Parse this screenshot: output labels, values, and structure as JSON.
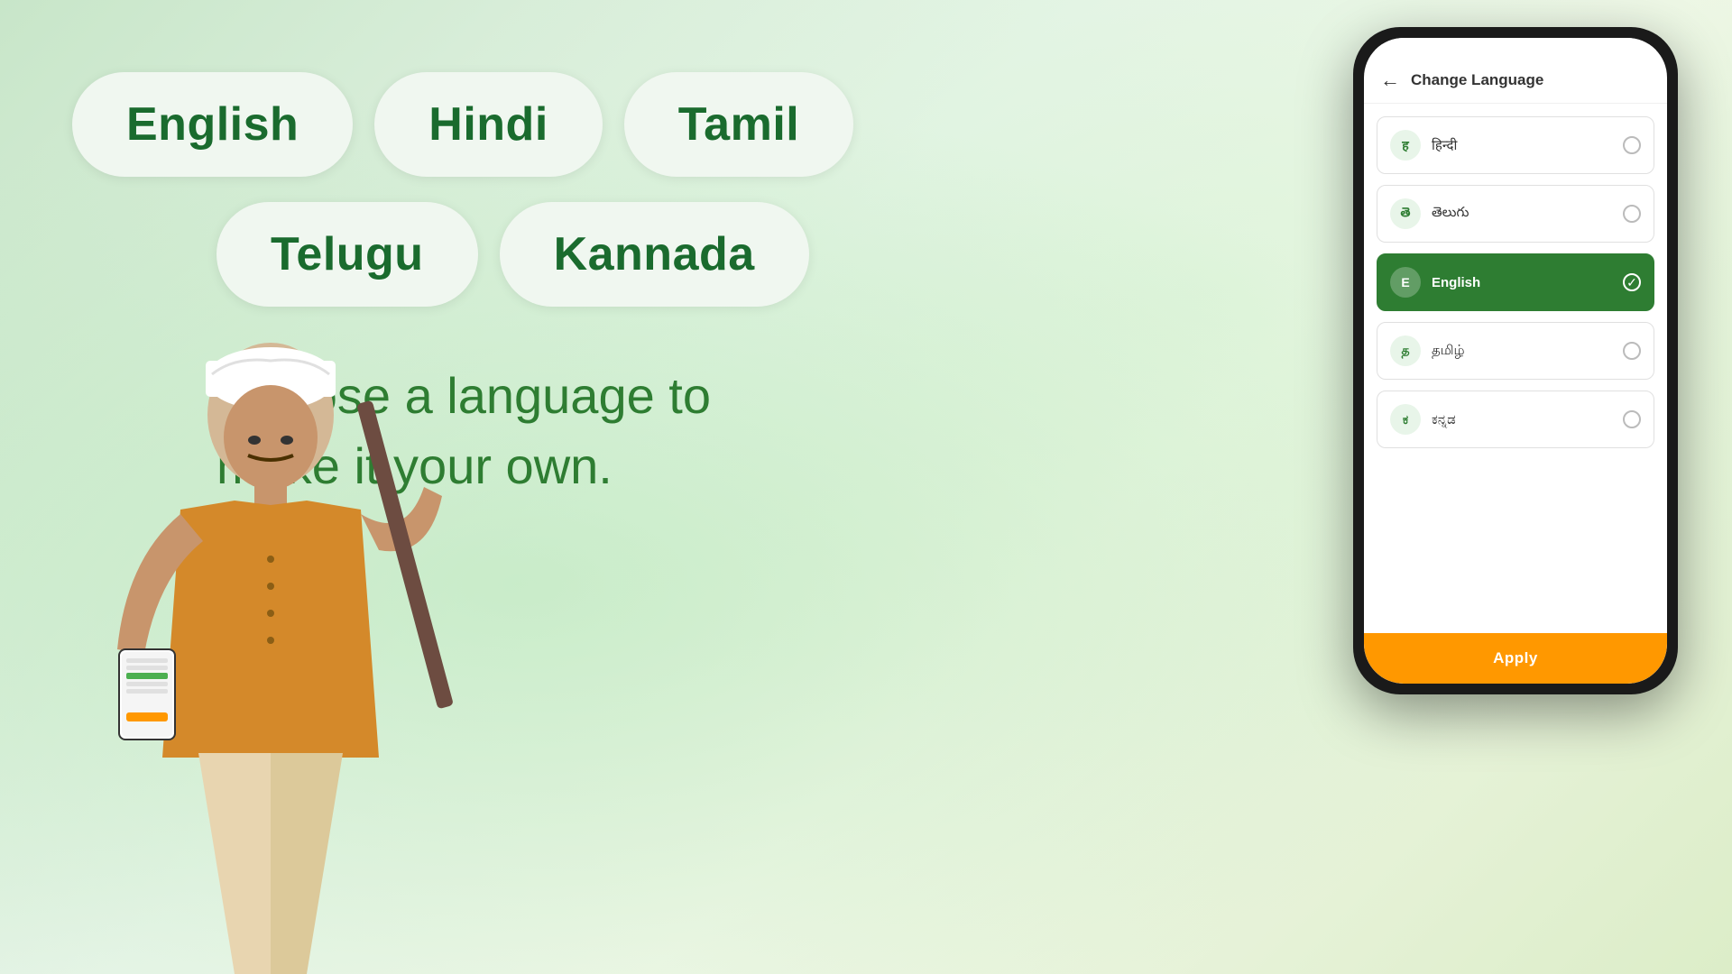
{
  "background": {
    "color1": "#c8e6c9",
    "color2": "#e8f5e9"
  },
  "pills": {
    "row1": [
      {
        "id": "english",
        "label": "English"
      },
      {
        "id": "hindi",
        "label": "Hindi"
      },
      {
        "id": "tamil",
        "label": "Tamil"
      }
    ],
    "row2": [
      {
        "id": "telugu",
        "label": "Telugu"
      },
      {
        "id": "kannada",
        "label": "Kannada"
      }
    ]
  },
  "tagline": {
    "line1": "Choose a language to",
    "line2": "make it your own."
  },
  "phone": {
    "title": "Change Language",
    "back_icon": "←",
    "languages": [
      {
        "id": "hindi",
        "icon": "ह",
        "label": "हिन्दी",
        "active": false
      },
      {
        "id": "telugu",
        "icon": "తె",
        "label": "తెలుగు",
        "active": false
      },
      {
        "id": "english",
        "icon": "E",
        "label": "English",
        "active": true
      },
      {
        "id": "tamil",
        "icon": "த",
        "label": "தமிழ்",
        "active": false
      },
      {
        "id": "kannada",
        "icon": "ಕ",
        "label": "ಕನ್ನಡ",
        "active": false
      }
    ],
    "apply_label": "Apply"
  }
}
